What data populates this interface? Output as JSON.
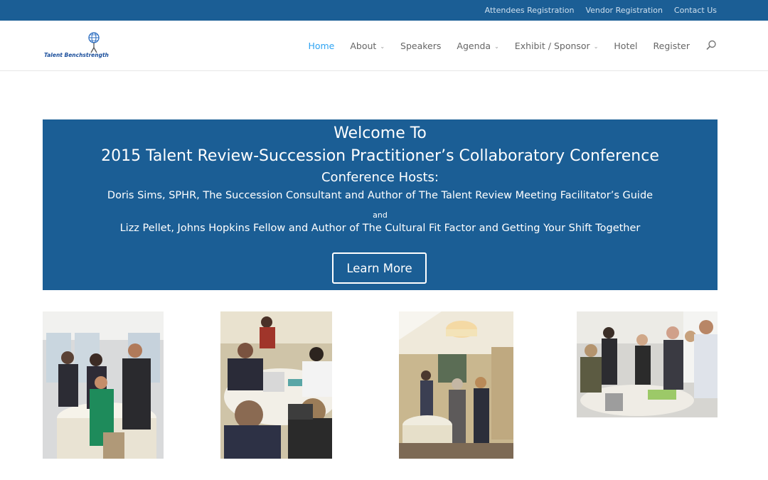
{
  "topbar": {
    "links": [
      "Attendees Registration",
      "Vendor Registration",
      "Contact Us"
    ]
  },
  "logo": {
    "text": "Talent Benchstrength"
  },
  "nav": {
    "items": [
      {
        "label": "Home",
        "active": true,
        "dropdown": false
      },
      {
        "label": "About",
        "active": false,
        "dropdown": true
      },
      {
        "label": "Speakers",
        "active": false,
        "dropdown": false
      },
      {
        "label": "Agenda",
        "active": false,
        "dropdown": true
      },
      {
        "label": "Exhibit / Sponsor",
        "active": false,
        "dropdown": true
      },
      {
        "label": "Hotel",
        "active": false,
        "dropdown": false
      },
      {
        "label": "Register",
        "active": false,
        "dropdown": false
      }
    ],
    "search_icon": "search-icon"
  },
  "hero": {
    "line1": "Welcome To",
    "line2": "2015 Talent Review-Succession Practitioner’s Collaboratory Conference",
    "line3": "Conference Hosts:",
    "line4": "Doris Sims, SPHR, The Succession Consultant and Author of The Talent Review Meeting Facilitator’s Guide",
    "line5": "and",
    "line6": "Lizz Pellet, Johns Hopkins Fellow and Author of The Cultural Fit Factor and Getting Your Shift Together",
    "button": "Learn More"
  },
  "colors": {
    "brand_blue": "#1b5e95",
    "active_link": "#2ea3f2"
  },
  "gallery": [
    "conference-photo-1",
    "conference-photo-2",
    "conference-photo-3",
    "conference-photo-4"
  ]
}
